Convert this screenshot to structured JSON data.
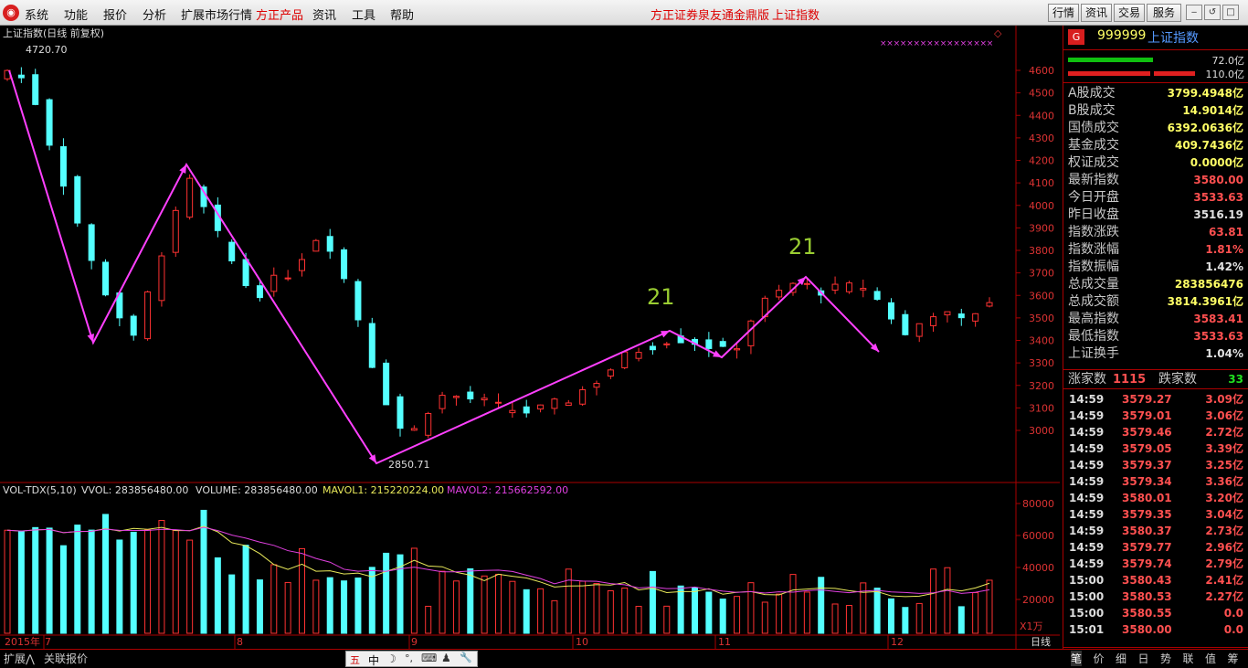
{
  "menu": {
    "logo_glyph": "◉",
    "items": [
      "系统",
      "功能",
      "报价",
      "分析",
      "扩展市场行情",
      "方正产品",
      "资讯",
      "工具",
      "帮助"
    ],
    "center_ad": "方正证券泉友通金鼎版",
    "center_index": "上证指数",
    "right_buttons": [
      "行情",
      "资讯",
      "交易",
      "服务"
    ],
    "window_buttons": [
      "‒",
      "↺",
      "□",
      "✕"
    ]
  },
  "chart": {
    "title": "上证指数(日线 前复权)",
    "high_mark": "4720.70",
    "low_mark": "2850.71",
    "wave_labels": [
      "21",
      "21"
    ],
    "price_ticks": [
      "4600",
      "4500",
      "4400",
      "4300",
      "4200",
      "4100",
      "4000",
      "3900",
      "3800",
      "3700",
      "3600",
      "3500",
      "3400",
      "3300",
      "3200",
      "3100",
      "3000"
    ],
    "vol_ticks": [
      "80000",
      "60000",
      "40000",
      "20000"
    ],
    "vol_unit": "X1万",
    "vol_header": {
      "name": "VOL-TDX(5,10)",
      "vvol": "VVOL: 283856480.00",
      "volume": "VOLUME: 283856480.00",
      "mavol1": "MAVOL1: 215220224.00",
      "mavol2": "MAVOL2: 215662592.00"
    },
    "date_labels": [
      "2015年",
      "7",
      "8",
      "9",
      "10",
      "11",
      "12"
    ],
    "period": "日线",
    "marker": "◇"
  },
  "chart_data": {
    "type": "candlestick",
    "high": 4720.7,
    "low": 2850.71,
    "y_range": [
      2850,
      4720
    ],
    "volume_range": [
      0,
      90000
    ],
    "volume_unit": "万",
    "mavol1": 215220224.0,
    "mavol2": 215662592.0,
    "volume": 283856480.0,
    "x_axis": [
      "2015年",
      "7",
      "8",
      "9",
      "10",
      "11",
      "12"
    ]
  },
  "sidebar": {
    "badge": "G",
    "code": "999999",
    "name": "上证指数",
    "bar1_value": "72.0亿",
    "bar2_value": "110.0亿",
    "bar1_fraction": 0.62,
    "bar2_fraction": 0.9,
    "stats": [
      {
        "k": "A股成交",
        "v": "3799.4948亿",
        "c": "#ffff66"
      },
      {
        "k": "B股成交",
        "v": "14.9014亿",
        "c": "#ffff66"
      },
      {
        "k": "国债成交",
        "v": "6392.0636亿",
        "c": "#ffff66"
      },
      {
        "k": "基金成交",
        "v": "409.7436亿",
        "c": "#ffff66"
      },
      {
        "k": "权证成交",
        "v": "0.0000亿",
        "c": "#ffff66"
      },
      {
        "k": "最新指数",
        "v": "3580.00",
        "c": "#ff5050"
      },
      {
        "k": "今日开盘",
        "v": "3533.63",
        "c": "#ff5050"
      },
      {
        "k": "昨日收盘",
        "v": "3516.19",
        "c": "#e0e0e0"
      },
      {
        "k": "指数涨跌",
        "v": "63.81",
        "c": "#ff5050"
      },
      {
        "k": "指数涨幅",
        "v": "1.81%",
        "c": "#ff5050"
      },
      {
        "k": "指数振幅",
        "v": "1.42%",
        "c": "#e0e0e0"
      },
      {
        "k": "总成交量",
        "v": "283856476",
        "c": "#ffff66"
      },
      {
        "k": "总成交额",
        "v": "3814.3961亿",
        "c": "#ffff66"
      },
      {
        "k": "最高指数",
        "v": "3583.41",
        "c": "#ff5050"
      },
      {
        "k": "最低指数",
        "v": "3533.63",
        "c": "#ff5050"
      },
      {
        "k": "上证换手",
        "v": "1.04%",
        "c": "#e0e0e0"
      }
    ],
    "up_label": "涨家数",
    "up_count": "1115",
    "down_label": "跌家数",
    "down_count": "33",
    "ticks": [
      {
        "t": "14:59",
        "p": "3579.27",
        "c": "3.09亿"
      },
      {
        "t": "14:59",
        "p": "3579.01",
        "c": "3.06亿"
      },
      {
        "t": "14:59",
        "p": "3579.46",
        "c": "2.72亿"
      },
      {
        "t": "14:59",
        "p": "3579.05",
        "c": "3.39亿"
      },
      {
        "t": "14:59",
        "p": "3579.37",
        "c": "3.25亿"
      },
      {
        "t": "14:59",
        "p": "3579.34",
        "c": "3.36亿"
      },
      {
        "t": "14:59",
        "p": "3580.01",
        "c": "3.20亿"
      },
      {
        "t": "14:59",
        "p": "3579.35",
        "c": "3.04亿"
      },
      {
        "t": "14:59",
        "p": "3580.37",
        "c": "2.73亿"
      },
      {
        "t": "14:59",
        "p": "3579.77",
        "c": "2.96亿"
      },
      {
        "t": "14:59",
        "p": "3579.74",
        "c": "2.79亿"
      },
      {
        "t": "15:00",
        "p": "3580.43",
        "c": "2.41亿"
      },
      {
        "t": "15:00",
        "p": "3580.53",
        "c": "2.27亿"
      },
      {
        "t": "15:00",
        "p": "3580.55",
        "c": "0.0"
      },
      {
        "t": "15:01",
        "p": "3580.00",
        "c": "0.0"
      }
    ],
    "tabs": [
      "笔",
      "价",
      "细",
      "日",
      "势",
      "联",
      "值",
      "筹"
    ]
  },
  "bottom": {
    "expand": "扩展⋀",
    "related": "关联报价",
    "ime": [
      "五",
      "中",
      "☽",
      "°,",
      "⌨",
      "♟",
      "🔧"
    ]
  }
}
